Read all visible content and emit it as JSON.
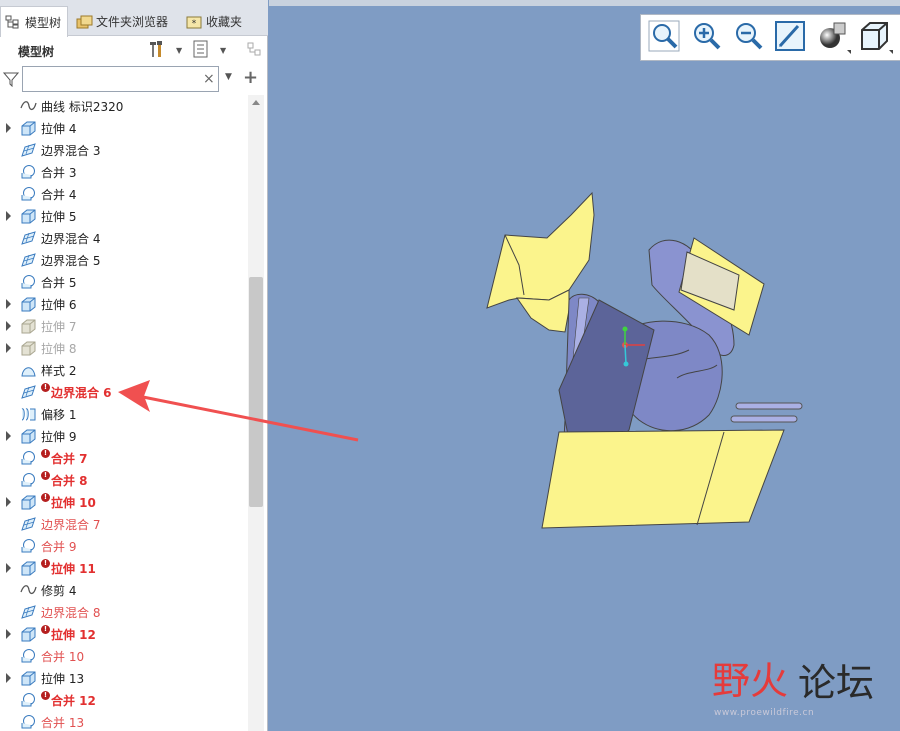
{
  "tabs": [
    {
      "label": "模型树",
      "icon": "model-tree-icon",
      "active": true
    },
    {
      "label": "文件夹浏览器",
      "icon": "folder-browser-icon",
      "active": false
    },
    {
      "label": "收藏夹",
      "icon": "favorites-icon",
      "active": false
    }
  ],
  "tree_header": {
    "title": "模型树",
    "settings_icon": "tools-icon",
    "show_icon": "list-icon",
    "extra_icon": "tree-filter-icon"
  },
  "search": {
    "value": "",
    "placeholder": ""
  },
  "tree_items": [
    {
      "label": "曲线 标识2320",
      "icon": "curve-icon",
      "expandable": false,
      "status": "normal"
    },
    {
      "label": "拉伸 4",
      "icon": "extrude-icon",
      "expandable": true,
      "status": "normal"
    },
    {
      "label": "边界混合 3",
      "icon": "boundary-blend-icon",
      "expandable": false,
      "status": "normal"
    },
    {
      "label": "合并 3",
      "icon": "merge-icon",
      "expandable": false,
      "status": "normal"
    },
    {
      "label": "合并 4",
      "icon": "merge-icon",
      "expandable": false,
      "status": "normal"
    },
    {
      "label": "拉伸 5",
      "icon": "extrude-icon",
      "expandable": true,
      "status": "normal"
    },
    {
      "label": "边界混合 4",
      "icon": "boundary-blend-icon",
      "expandable": false,
      "status": "normal"
    },
    {
      "label": "边界混合 5",
      "icon": "boundary-blend-icon",
      "expandable": false,
      "status": "normal"
    },
    {
      "label": "合并 5",
      "icon": "merge-icon",
      "expandable": false,
      "status": "normal"
    },
    {
      "label": "拉伸 6",
      "icon": "extrude-icon",
      "expandable": true,
      "status": "normal"
    },
    {
      "label": "拉伸 7",
      "icon": "extrude-suppressed-icon",
      "expandable": true,
      "status": "grey"
    },
    {
      "label": "拉伸 8",
      "icon": "extrude-suppressed-icon",
      "expandable": true,
      "status": "grey"
    },
    {
      "label": "样式 2",
      "icon": "style-icon",
      "expandable": false,
      "status": "normal"
    },
    {
      "label": "边界混合 6",
      "icon": "boundary-blend-icon",
      "expandable": false,
      "status": "error"
    },
    {
      "label": "偏移 1",
      "icon": "offset-icon",
      "expandable": false,
      "status": "normal"
    },
    {
      "label": "拉伸 9",
      "icon": "extrude-icon",
      "expandable": true,
      "status": "normal"
    },
    {
      "label": "合并 7",
      "icon": "merge-icon",
      "expandable": false,
      "status": "error"
    },
    {
      "label": "合并 8",
      "icon": "merge-icon",
      "expandable": false,
      "status": "error"
    },
    {
      "label": "拉伸 10",
      "icon": "extrude-icon",
      "expandable": true,
      "status": "error"
    },
    {
      "label": "边界混合 7",
      "icon": "boundary-blend-icon",
      "expandable": false,
      "status": "red"
    },
    {
      "label": "合并 9",
      "icon": "merge-icon",
      "expandable": false,
      "status": "red"
    },
    {
      "label": "拉伸 11",
      "icon": "extrude-icon",
      "expandable": true,
      "status": "error"
    },
    {
      "label": "修剪 4",
      "icon": "trim-icon",
      "expandable": false,
      "status": "normal"
    },
    {
      "label": "边界混合 8",
      "icon": "boundary-blend-icon",
      "expandable": false,
      "status": "red"
    },
    {
      "label": "拉伸 12",
      "icon": "extrude-icon",
      "expandable": true,
      "status": "error"
    },
    {
      "label": "合并 10",
      "icon": "merge-icon",
      "expandable": false,
      "status": "red"
    },
    {
      "label": "拉伸 13",
      "icon": "extrude-icon",
      "expandable": true,
      "status": "normal"
    },
    {
      "label": "合并 12",
      "icon": "merge-icon",
      "expandable": false,
      "status": "error"
    },
    {
      "label": "合并 13",
      "icon": "merge-icon",
      "expandable": false,
      "status": "red"
    }
  ],
  "view_toolbar": [
    {
      "icon": "zoom-fit-icon",
      "dropdown": false
    },
    {
      "icon": "zoom-in-icon",
      "dropdown": false
    },
    {
      "icon": "zoom-out-icon",
      "dropdown": false
    },
    {
      "icon": "sketch-view-icon",
      "dropdown": false
    },
    {
      "icon": "display-style-icon",
      "dropdown": true
    },
    {
      "icon": "saved-orientations-icon",
      "dropdown": true
    }
  ],
  "watermark": {
    "text_part_1": "野火",
    "text_part_2": "论坛",
    "url": "www.proewildfire.cn"
  },
  "colors": {
    "viewport_bg": "#7f9cc4",
    "surface_yellow": "#fbf48c",
    "surface_blue": "#8a93d0",
    "error_red": "#e23030",
    "arrow_red": "#f05050"
  }
}
